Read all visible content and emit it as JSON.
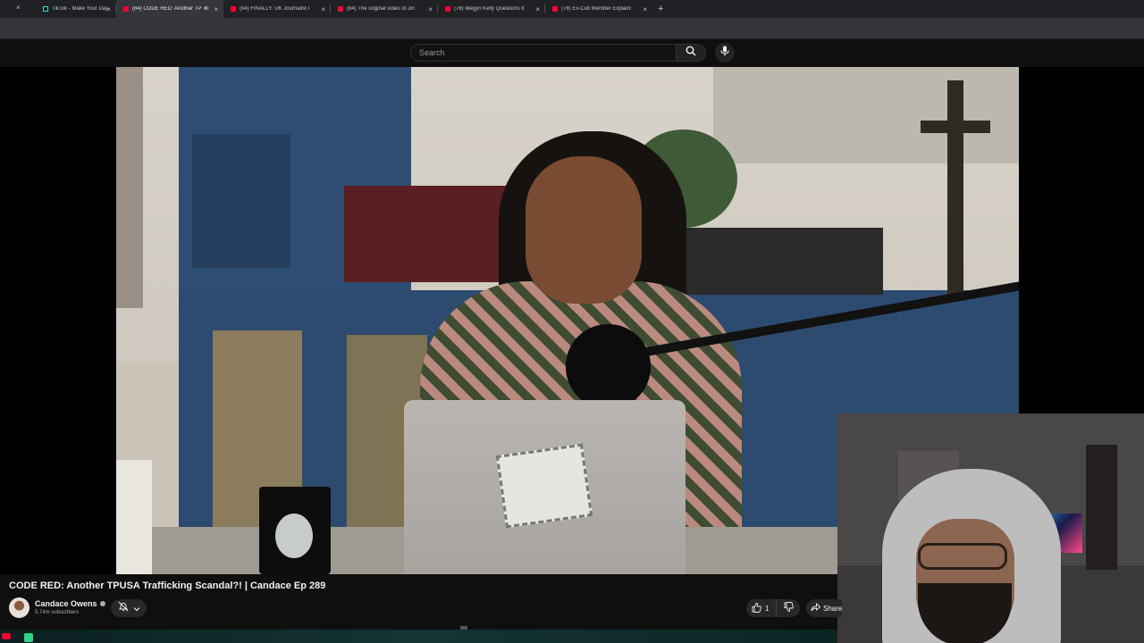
{
  "browser": {
    "tabs": [
      {
        "title": "TikTok - Make Your Day",
        "favicon": "tiktok-icon",
        "active": false
      },
      {
        "title": "(84) CODE RED: Another TP",
        "favicon": "youtube-icon",
        "active": true,
        "audio": true
      },
      {
        "title": "(84) FINALLY: UK Journalist CON",
        "favicon": "youtube-icon",
        "active": false
      },
      {
        "title": "(84) The original video of Jin sh",
        "favicon": "youtube-icon",
        "active": false
      },
      {
        "title": "(78) Megyn Kelly Questions the",
        "favicon": "youtube-icon",
        "active": false
      },
      {
        "title": "(78) Ex-Cult Member Explains H",
        "favicon": "youtube-icon",
        "active": false
      }
    ],
    "new_tab": "+",
    "close_glyph": "×"
  },
  "header": {
    "search_placeholder": "Search"
  },
  "video": {
    "title": "CODE RED: Another TPUSA Trafficking Scandal?! | Candace Ep 289",
    "channel_name": "Candace Owens",
    "subscribers": "5.74m subscribers",
    "likes": "1",
    "share_label": "Share"
  },
  "colors": {
    "background": "#0f0f0f",
    "youtube_red": "#ff0033",
    "chip": "#272727"
  }
}
